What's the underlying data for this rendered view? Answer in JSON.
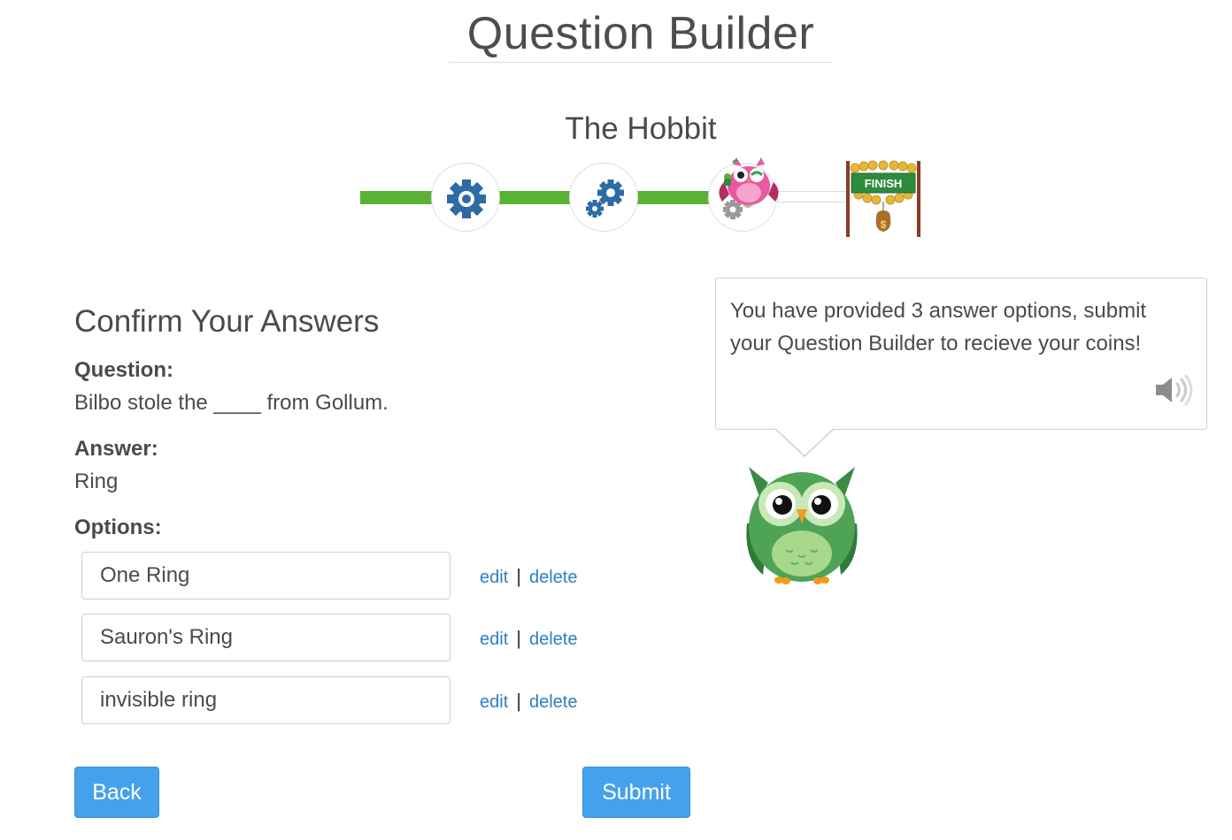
{
  "header": {
    "title": "Question Builder",
    "book_title": "The Hobbit"
  },
  "progress": {
    "steps": [
      "gear-step-1",
      "gears-step-2",
      "current-step-3"
    ],
    "finish_label": "FINISH",
    "finish_money_symbol": "$",
    "completed_steps": 3,
    "colors": {
      "done": "#5ab235",
      "todo": "#ffffff"
    }
  },
  "confirm": {
    "heading": "Confirm Your Answers",
    "question_label": "Question:",
    "question_text": "Bilbo stole the ____ from Gollum.",
    "answer_label": "Answer:",
    "answer_text": "Ring",
    "options_label": "Options:",
    "options": [
      {
        "value": "One Ring",
        "edit": "edit",
        "separator": "|",
        "delete": "delete"
      },
      {
        "value": "Sauron's Ring",
        "edit": "edit",
        "separator": "|",
        "delete": "delete"
      },
      {
        "value": "invisible ring",
        "edit": "edit",
        "separator": "|",
        "delete": "delete"
      }
    ]
  },
  "buttons": {
    "back": "Back",
    "submit": "Submit",
    "color": "#45a1ec"
  },
  "bubble": {
    "message": "You have provided 3 answer options, submit your Question Builder to recieve your coins!",
    "speaker_icon": "speaker-icon"
  }
}
